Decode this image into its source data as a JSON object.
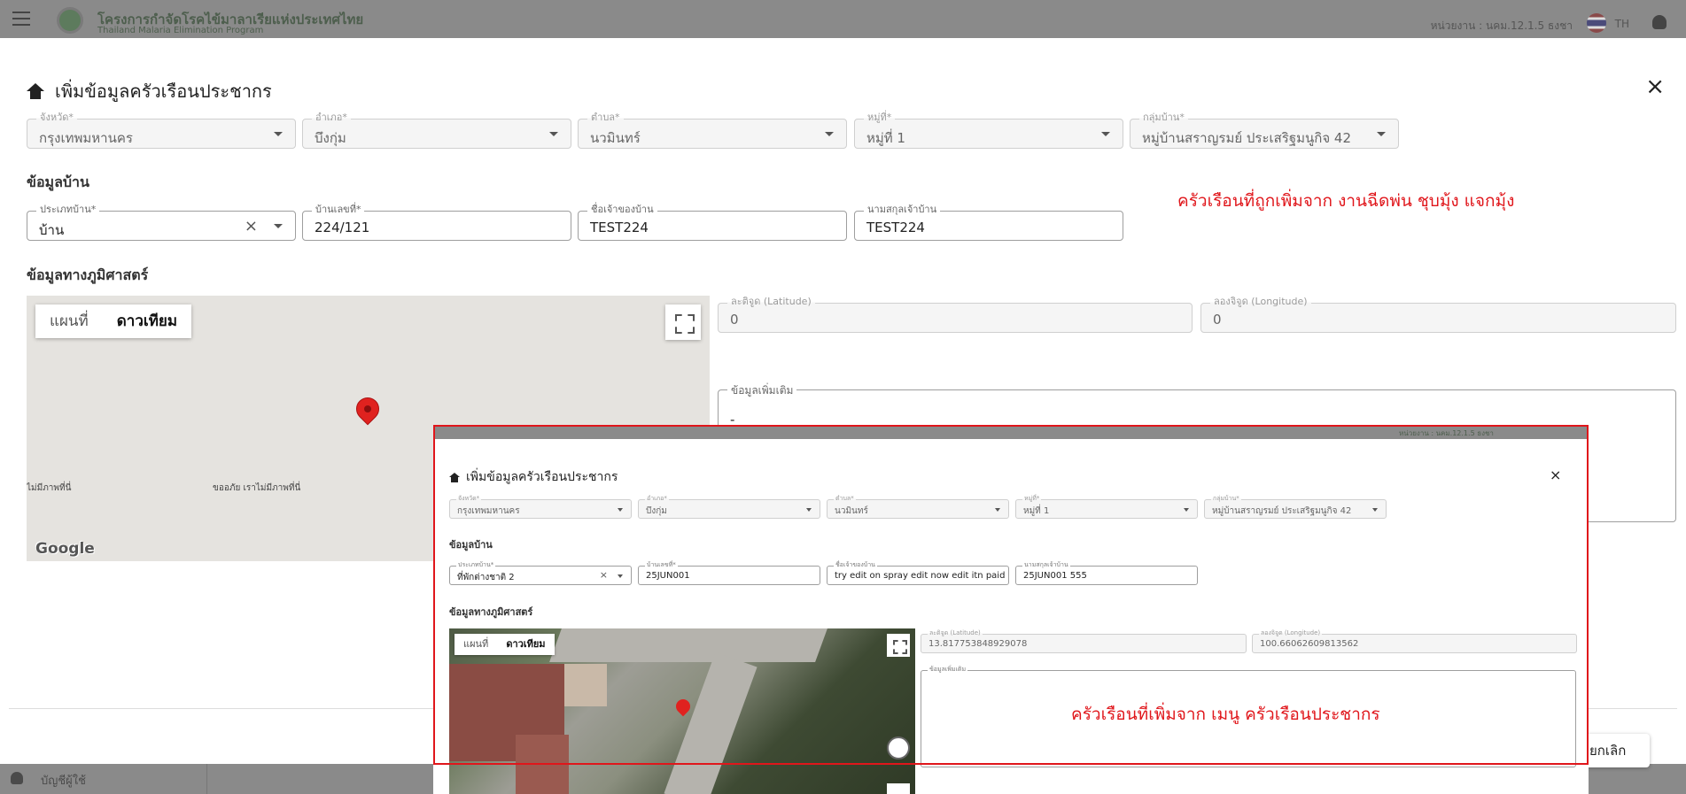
{
  "app": {
    "brand_th": "โครงการกำจัดโรคไข้มาลาเรียแห่งประเทศไทย",
    "brand_en": "Thailand Malaria Elimination Program",
    "unit": "หน่วยงาน : นคม.12.1.5 ธงชา",
    "lang": "TH",
    "footer_item": "บัญชีผู้ใช้"
  },
  "dialog": {
    "title": "เพิ่มข้อมูลครัวเรือนประชากร",
    "location": [
      {
        "label": "จังหวัด*",
        "value": "กรุงเทพมหานคร"
      },
      {
        "label": "อำเภอ*",
        "value": "บึงกุ่ม"
      },
      {
        "label": "ตำบล*",
        "value": "นวมินทร์"
      },
      {
        "label": "หมู่ที่*",
        "value": "หมู่ที่ 1"
      },
      {
        "label": "กลุ่มบ้าน*",
        "value": "หมู่บ้านสราญรมย์ ประเสริฐมนูกิจ 42"
      }
    ],
    "house_section": "ข้อมูลบ้าน",
    "house": {
      "type_label": "ประเภทบ้าน*",
      "type_value": "บ้าน",
      "no_label": "บ้านเลขที่*",
      "no_value": "224/121",
      "owner_label": "ชื่อเจ้าของบ้าน",
      "owner_value": "TEST224",
      "surname_label": "นามสกุลเจ้าบ้าน",
      "surname_value": "TEST224"
    },
    "geo_section": "ข้อมูลทางภูมิศาสตร์",
    "map": {
      "tab_map": "แผนที่",
      "tab_satellite": "ดาวเทียม",
      "no_imagery_left": "ไม่มีภาพที่นี่",
      "no_imagery_center": "ขออภัย เราไม่มีภาพที่นี่",
      "google": "Google"
    },
    "lat_label": "ละติจูด (Latitude)",
    "lat_value": "0",
    "lng_label": "ลองจิจูด (Longitude)",
    "lng_value": "0",
    "extra_label": "ข้อมูลเพิ่มเติม",
    "extra_value": "-",
    "cancel": "ยกเลิก",
    "clear_icon": "×",
    "close_icon": "×"
  },
  "annotations": {
    "top_note": "ครัวเรือนที่ถูกเพิ่มจาก  งานฉีดพ่น ชุบมุ้ง แจกมุ้ง",
    "inset_note": "ครัวเรือนที่เพิ่มจาก  เมนู ครัวเรือนประชากร",
    "color": "#e0161b"
  },
  "inset": {
    "title": "เพิ่มข้อมูลครัวเรือนประชากร",
    "location": [
      {
        "label": "จังหวัด*",
        "value": "กรุงเทพมหานคร"
      },
      {
        "label": "อำเภอ*",
        "value": "บึงกุ่ม"
      },
      {
        "label": "ตำบล*",
        "value": "นวมินทร์"
      },
      {
        "label": "หมู่ที่*",
        "value": "หมู่ที่ 1"
      },
      {
        "label": "กลุ่มบ้าน*",
        "value": "หมู่บ้านสราญรมย์ ประเสริฐมนูกิจ 42"
      }
    ],
    "house_section": "ข้อมูลบ้าน",
    "house": {
      "type_label": "ประเภทบ้าน*",
      "type_value": "ที่พักต่างชาติ 2",
      "no_label": "บ้านเลขที่*",
      "no_value": "25JUN001",
      "owner_label": "ชื่อเจ้าของบ้าน",
      "owner_value": "try edit on spray edit now edit itn paid",
      "surname_label": "นามสกุลเจ้าบ้าน",
      "surname_value": "25JUN001 555"
    },
    "geo_section": "ข้อมูลทางภูมิศาสตร์",
    "tab_map": "แผนที่",
    "tab_satellite": "ดาวเทียม",
    "lat_label": "ละติจูด (Latitude)",
    "lat_value": "13.817753848929078",
    "lng_label": "ลองจิจูด (Longitude)",
    "lng_value": "100.66062609813562",
    "extra_label": "ข้อมูลเพิ่มเติม",
    "unit": "หน่วยงาน : นคม.12.1.5 ธงชา"
  }
}
